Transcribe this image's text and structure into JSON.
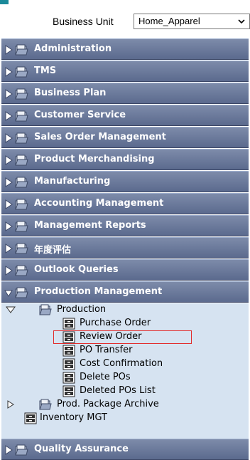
{
  "business_unit": {
    "label": "Business Unit",
    "selected": "Home_Apparel"
  },
  "menu": [
    {
      "label": "Administration",
      "expanded": false
    },
    {
      "label": "TMS",
      "expanded": false
    },
    {
      "label": "Business Plan",
      "expanded": false
    },
    {
      "label": "Customer Service",
      "expanded": false
    },
    {
      "label": "Sales Order Management",
      "expanded": false
    },
    {
      "label": "Product Merchandising",
      "expanded": false
    },
    {
      "label": "Manufacturing",
      "expanded": false
    },
    {
      "label": "Accounting Management",
      "expanded": false
    },
    {
      "label": "Management Reports",
      "expanded": false
    },
    {
      "label": "年度评估",
      "expanded": false
    },
    {
      "label": "Outlook Queries",
      "expanded": false
    },
    {
      "label": "Production Management",
      "expanded": true
    },
    {
      "label": "Quality Assurance",
      "expanded": false
    }
  ],
  "production_management": {
    "production_folder": "Production",
    "production_items": [
      "Purchase Order",
      "Review Order",
      "PO Transfer",
      "Cost Confirmation",
      "Delete POs",
      "Deleted POs List"
    ],
    "highlighted_item": "Review Order",
    "archive_folder": "Prod. Package Archive",
    "inventory_item": "Inventory MGT"
  },
  "colors": {
    "menu_bar": "#6b7a9c",
    "sub_bg": "#d6e3f1",
    "highlight_border": "#e22a2a"
  }
}
